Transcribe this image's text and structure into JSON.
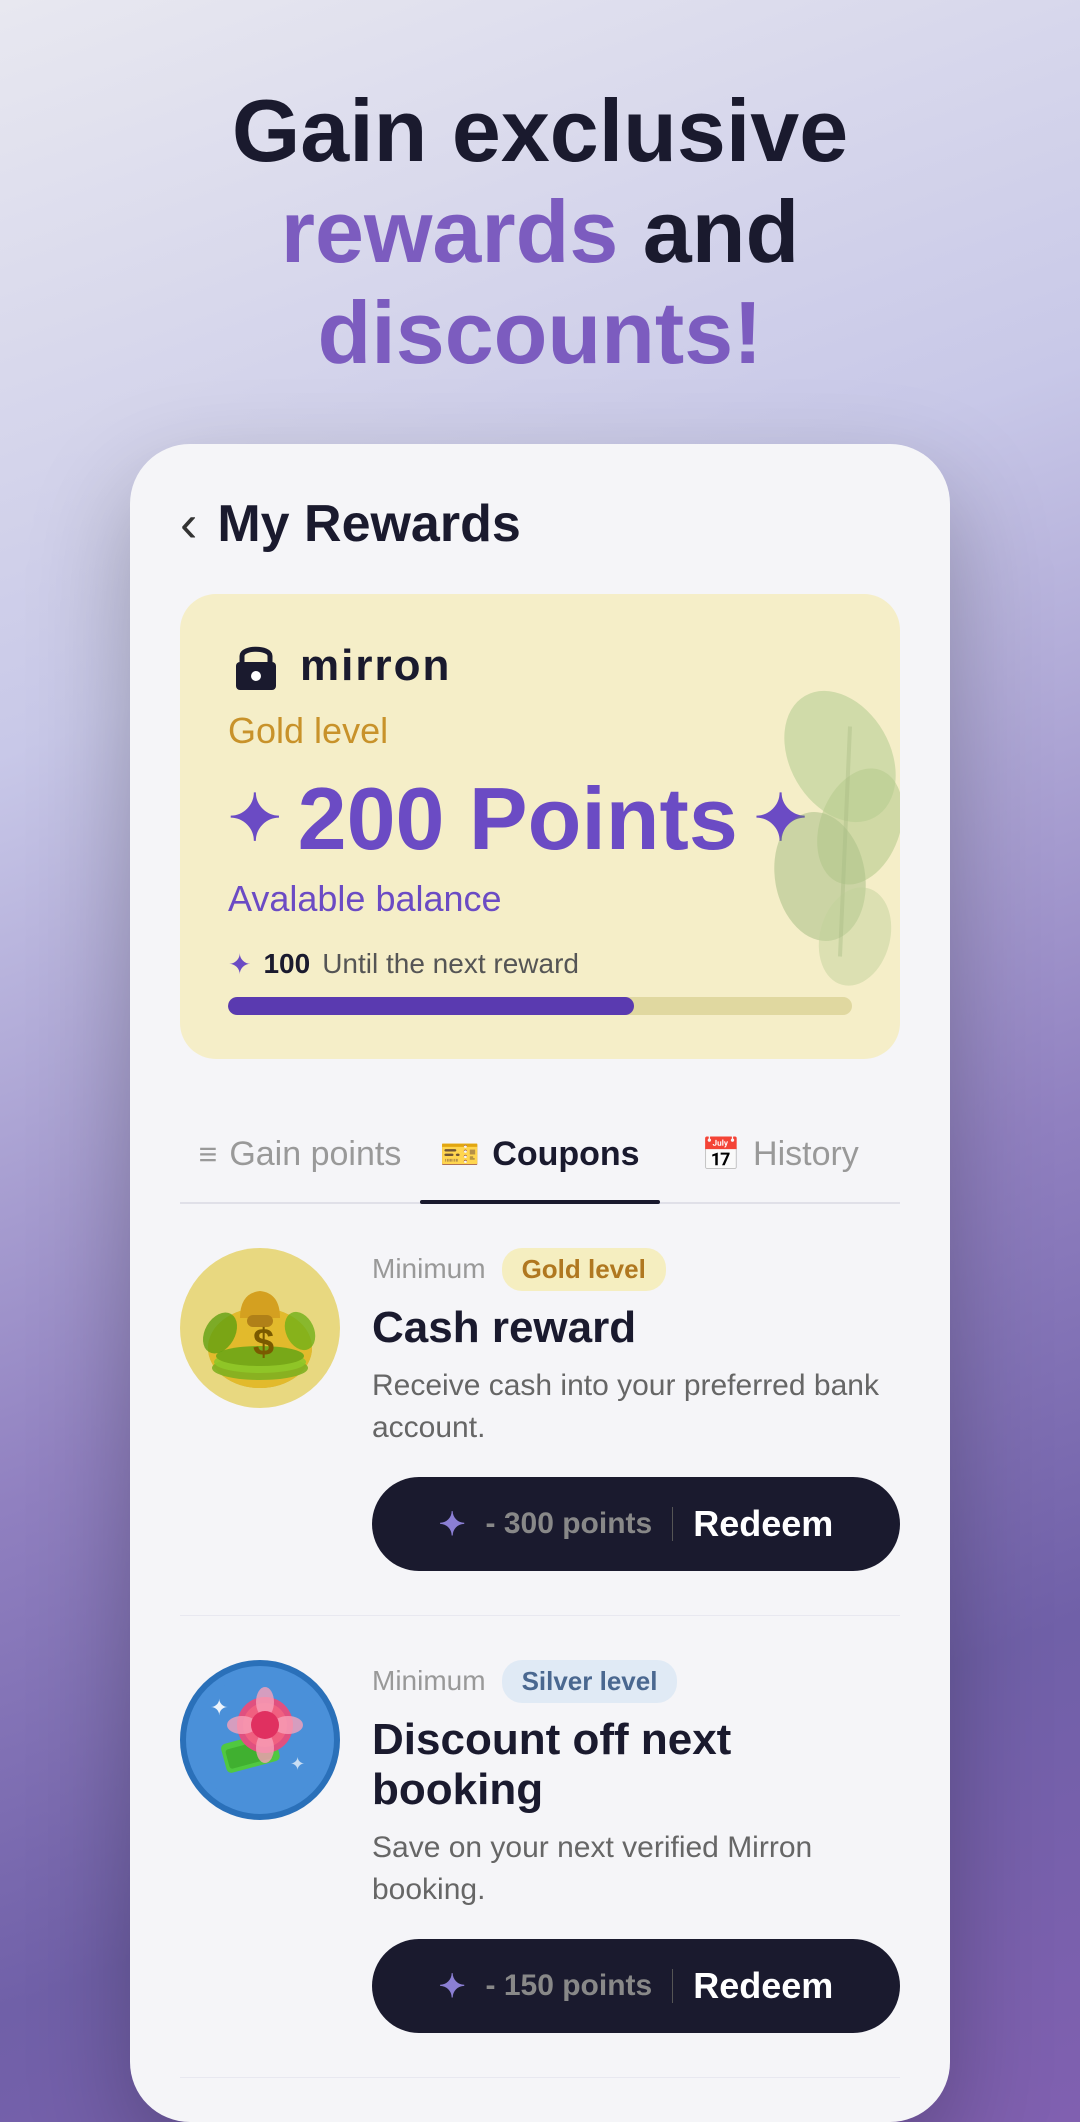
{
  "hero": {
    "line1": "Gain exclusive",
    "line2_accent": "rewards",
    "line2_rest": " and",
    "line3_accent": "discounts!"
  },
  "header": {
    "back_label": "‹",
    "title": "My Rewards"
  },
  "points_card": {
    "brand_name": "mirron",
    "level": "Gold level",
    "points": "200 Points",
    "available_label": "Avalable balance",
    "next_reward_prefix": "✦",
    "next_reward_num": "100",
    "next_reward_suffix": "Until the next reward",
    "progress_percent": 65
  },
  "tabs": [
    {
      "id": "gain",
      "label": "Gain points",
      "icon": "≡"
    },
    {
      "id": "coupons",
      "label": "Coupons",
      "icon": "🎫",
      "active": true
    },
    {
      "id": "history",
      "label": "History",
      "icon": "📅"
    }
  ],
  "coupons": [
    {
      "id": "cash",
      "minimum_label": "Minimum",
      "badge": "Gold level",
      "badge_type": "gold",
      "name": "Cash reward",
      "description": "Receive cash into your preferred bank account.",
      "redeem_points": "- 300 points",
      "redeem_label": "Redeem"
    },
    {
      "id": "discount",
      "minimum_label": "Minimum",
      "badge": "Silver level",
      "badge_type": "silver",
      "name": "Discount off next booking",
      "description": "Save on your next verified Mirron booking.",
      "redeem_points": "- 150 points",
      "redeem_label": "Redeem"
    }
  ]
}
